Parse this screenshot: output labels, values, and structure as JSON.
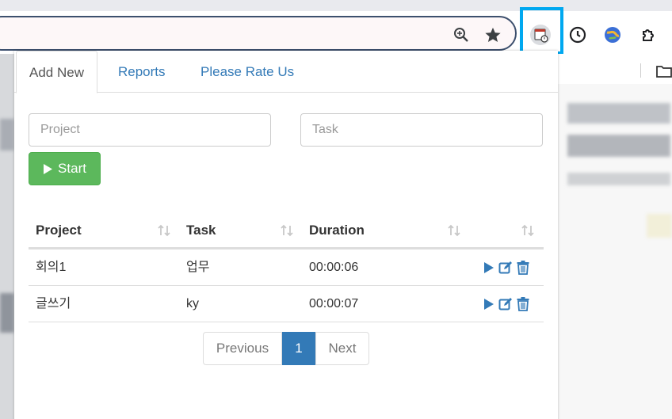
{
  "browser": {
    "toolbar_icons": [
      "zoom-icon",
      "bookmark-star-icon",
      "time-tracker-extension-icon",
      "clock-extension-icon",
      "globe-extension-icon",
      "extensions-puzzle-icon"
    ]
  },
  "popup": {
    "tabs": [
      {
        "label": "Add New",
        "active": true
      },
      {
        "label": "Reports",
        "active": false
      },
      {
        "label": "Please Rate Us",
        "active": false
      }
    ],
    "form": {
      "project_placeholder": "Project",
      "task_placeholder": "Task",
      "start_label": "Start"
    },
    "table": {
      "headers": [
        "Project",
        "Task",
        "Duration"
      ],
      "rows": [
        {
          "project": "회의1",
          "task": "업무",
          "duration": "00:00:06"
        },
        {
          "project": "글쓰기",
          "task": "ky",
          "duration": "00:00:07"
        }
      ]
    },
    "pagination": {
      "previous_label": "Previous",
      "current_page": "1",
      "next_label": "Next"
    }
  },
  "colors": {
    "link": "#337ab7",
    "start_button": "#5cb85c",
    "highlight_box": "#00a8f0"
  }
}
